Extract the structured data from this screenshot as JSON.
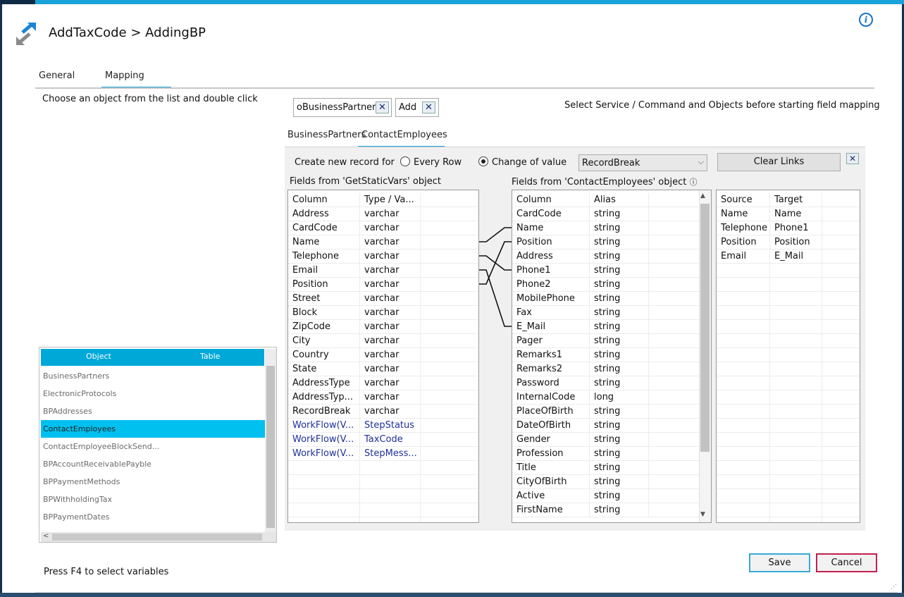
{
  "window": {
    "title": "AddTaxCode > AddingBP",
    "info_icon": "i"
  },
  "tabs": [
    {
      "label": "General"
    },
    {
      "label": "Mapping"
    }
  ],
  "left": {
    "instruction": "Choose an object from the list and double click",
    "list_header": {
      "object": "Object",
      "table": "Table"
    },
    "objects": [
      "BusinessPartners",
      "ElectronicProtocols",
      "BPAddresses",
      "ContactEmployees",
      "ContactEmployeeBlockSend...",
      "BPAccountReceivablePayble",
      "BPPaymentMethods",
      "BPWithholdingTax",
      "BPPaymentDates"
    ],
    "selected_object": "ContactEmployees",
    "scroll_left_arrow": "<",
    "footer_hint": "Press F4 to select variables"
  },
  "chips": [
    {
      "label": "oBusinessPartners",
      "close": "✕"
    },
    {
      "label": "Add",
      "close": "✕"
    }
  ],
  "select_message": "Select Service / Command and Objects before starting field mapping",
  "subtabs": [
    {
      "label": "BusinessPartners"
    },
    {
      "label": "ContactEmployees"
    }
  ],
  "mapping": {
    "create_label": "Create new record for",
    "radio_every_row": "Every Row",
    "radio_change_value": "Change of value",
    "selected_mode": "Change of value",
    "dropdown_value": "RecordBreak",
    "clear_links_label": "Clear Links",
    "close_label": "✕",
    "source_title": "Fields from 'GetStaticVars' object",
    "target_title": "Fields from 'ContactEmployees' object",
    "target_info_icon": "ⓘ",
    "source_headers": [
      "Column",
      "Type / Va..."
    ],
    "source_rows": [
      [
        "Address",
        "varchar"
      ],
      [
        "CardCode",
        "varchar"
      ],
      [
        "Name",
        "varchar"
      ],
      [
        "Telephone",
        "varchar"
      ],
      [
        "Email",
        "varchar"
      ],
      [
        "Position",
        "varchar"
      ],
      [
        "Street",
        "varchar"
      ],
      [
        "Block",
        "varchar"
      ],
      [
        "ZipCode",
        "varchar"
      ],
      [
        "City",
        "varchar"
      ],
      [
        "Country",
        "varchar"
      ],
      [
        "State",
        "varchar"
      ],
      [
        "AddressType",
        "varchar"
      ],
      [
        "AddressTyp...",
        "varchar"
      ],
      [
        "RecordBreak",
        "varchar"
      ],
      [
        "WorkFlow(V...",
        "StepStatus"
      ],
      [
        "WorkFlow(V...",
        "TaxCode"
      ],
      [
        "WorkFlow(V...",
        "StepMess..."
      ]
    ],
    "target_headers": [
      "Column",
      "Alias"
    ],
    "target_rows": [
      [
        "CardCode",
        "string"
      ],
      [
        "Name",
        "string"
      ],
      [
        "Position",
        "string"
      ],
      [
        "Address",
        "string"
      ],
      [
        "Phone1",
        "string"
      ],
      [
        "Phone2",
        "string"
      ],
      [
        "MobilePhone",
        "string"
      ],
      [
        "Fax",
        "string"
      ],
      [
        "E_Mail",
        "string"
      ],
      [
        "Pager",
        "string"
      ],
      [
        "Remarks1",
        "string"
      ],
      [
        "Remarks2",
        "string"
      ],
      [
        "Password",
        "string"
      ],
      [
        "InternalCode",
        "long"
      ],
      [
        "PlaceOfBirth",
        "string"
      ],
      [
        "DateOfBirth",
        "string"
      ],
      [
        "Gender",
        "string"
      ],
      [
        "Profession",
        "string"
      ],
      [
        "Title",
        "string"
      ],
      [
        "CityOfBirth",
        "string"
      ],
      [
        "Active",
        "string"
      ],
      [
        "FirstName",
        "string"
      ]
    ],
    "links_headers": [
      "Source",
      "Target"
    ],
    "links_rows": [
      [
        "Name",
        "Name"
      ],
      [
        "Telephone",
        "Phone1"
      ],
      [
        "Position",
        "Position"
      ],
      [
        "Email",
        "E_Mail"
      ]
    ]
  },
  "buttons": {
    "save": "Save",
    "cancel": "Cancel"
  }
}
